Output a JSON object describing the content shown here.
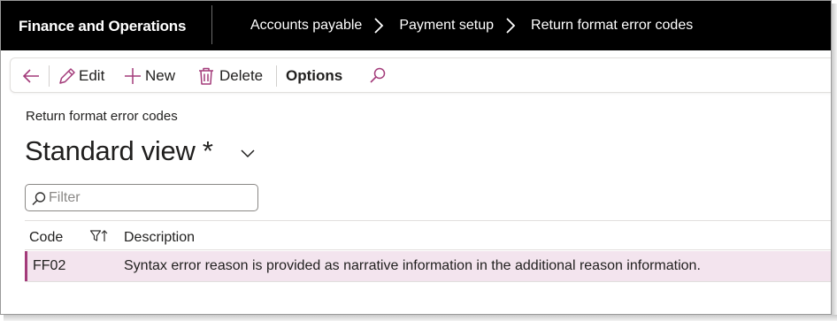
{
  "nav": {
    "app_title": "Finance and Operations",
    "breadcrumbs": [
      "Accounts payable",
      "Payment setup",
      "Return format error codes"
    ]
  },
  "toolbar": {
    "edit_label": "Edit",
    "new_label": "New",
    "delete_label": "Delete",
    "options_label": "Options"
  },
  "page": {
    "caption": "Return format error codes",
    "view_title": "Standard view *"
  },
  "filter": {
    "placeholder": "Filter",
    "value": ""
  },
  "grid": {
    "columns": [
      "Code",
      "Description"
    ],
    "rows": [
      {
        "code": "FF02",
        "description": "Syntax error reason is provided as narrative information in the additional reason information.",
        "selected": true
      }
    ]
  },
  "icons": {
    "back": "back-arrow-icon",
    "edit": "pencil-icon",
    "new": "plus-icon",
    "delete": "trash-icon",
    "search": "search-icon",
    "view_dropdown": "chevron-down-icon",
    "filter": "search-icon",
    "column_sort": "filter-sort-icon"
  },
  "colors": {
    "nav_bg": "#000000",
    "accent": "#a33b7a",
    "selected_row_bg": "#f3e4ee"
  }
}
